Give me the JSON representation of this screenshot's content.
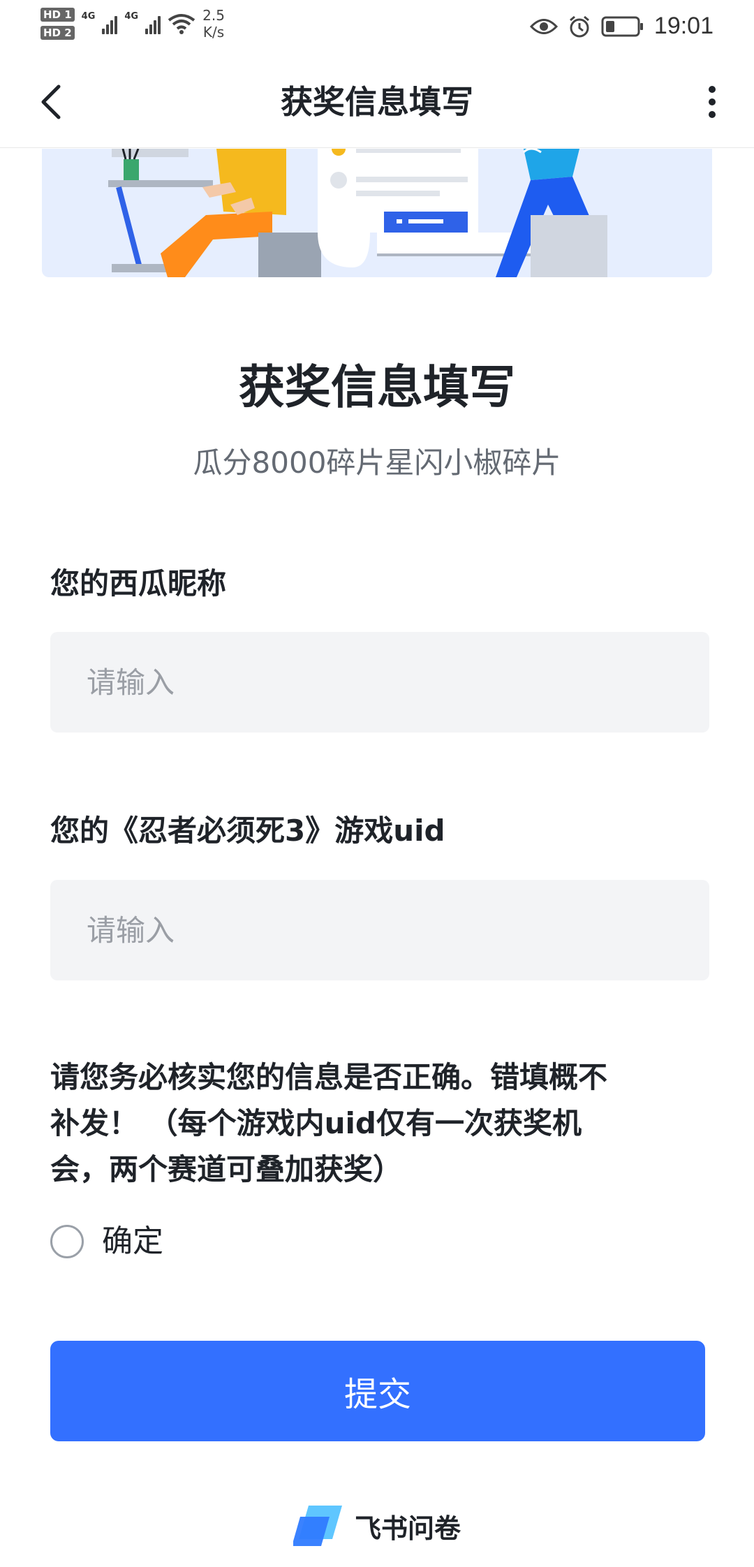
{
  "status_bar": {
    "sim1": "HD 1",
    "sim2": "HD 2",
    "network1": "4G",
    "network2": "4G",
    "speed_value": "2.5",
    "speed_unit": "K/s",
    "time": "19:01"
  },
  "nav": {
    "title": "获奖信息填写",
    "back_icon": "chevron-left-icon",
    "more_icon": "more-vertical-icon"
  },
  "form": {
    "title": "获奖信息填写",
    "subtitle": "瓜分8000碎片星闪小椒碎片",
    "questions": [
      {
        "label": "您的西瓜昵称",
        "placeholder": "请输入",
        "value": ""
      },
      {
        "label": "您的《忍者必须死3》游戏uid",
        "placeholder": "请输入",
        "value": ""
      }
    ],
    "notice_lines": [
      "请您务必核实您的信息是否正确。错填概不",
      "补发！ （每个游戏内uid仅有一次获奖机",
      "会，两个赛道可叠加获奖）"
    ],
    "confirm_option": {
      "label": "确定",
      "checked": false
    },
    "submit_label": "提交"
  },
  "footer": {
    "brand": "飞书问卷",
    "logo_icon": "feishu-survey-logo-icon"
  },
  "colors": {
    "primary": "#3370ff",
    "input_bg": "#f3f4f6",
    "banner_bg": "#e6eefe",
    "text": "#1f2329",
    "subtext": "#646a73"
  }
}
